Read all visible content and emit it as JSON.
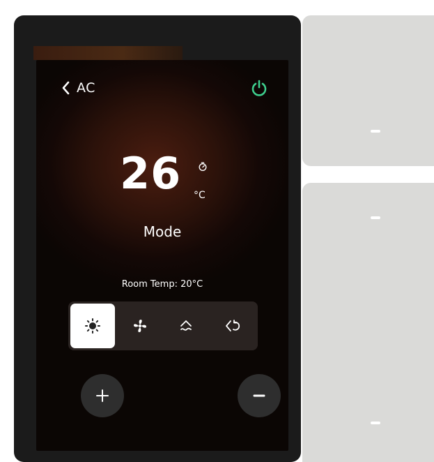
{
  "header": {
    "back_label": "AC",
    "power_icon": "power-icon",
    "power_color": "#3ecf8e"
  },
  "climate": {
    "temperature": "26",
    "unit": "°C",
    "timer_icon": "timer-icon",
    "mode_label": "Mode",
    "room_temp": "Room Temp: 20°C"
  },
  "modes": [
    {
      "icon": "sun-icon",
      "name": "heat",
      "selected": true
    },
    {
      "icon": "fan-icon",
      "name": "fan",
      "selected": false
    },
    {
      "icon": "dry-icon",
      "name": "dry",
      "selected": false
    },
    {
      "icon": "auto-icon",
      "name": "auto",
      "selected": false
    }
  ],
  "controls": {
    "increase_icon": "plus-icon",
    "decrease_icon": "minus-icon"
  },
  "side_buttons": [
    {
      "name": "top-right-button"
    },
    {
      "name": "bottom-right-button"
    }
  ]
}
